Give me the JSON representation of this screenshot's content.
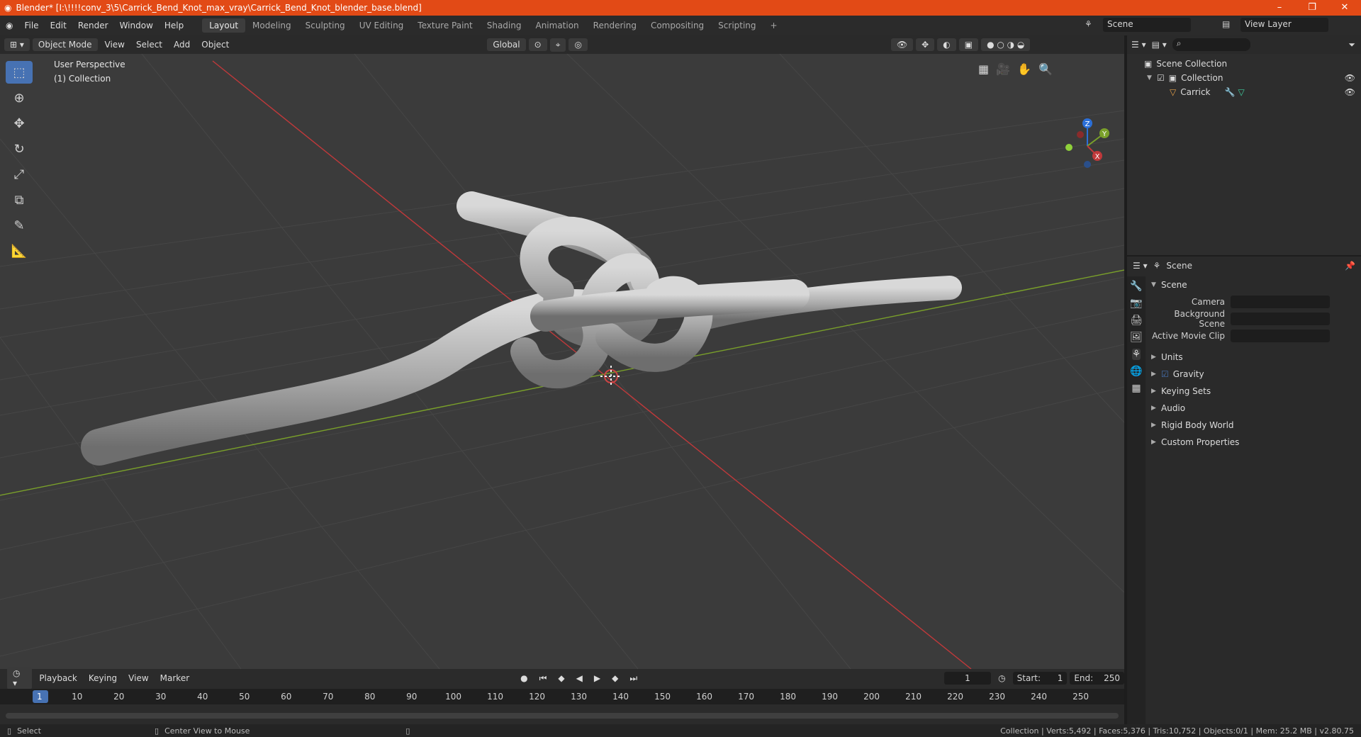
{
  "title": "Blender* [I:\\!!!!conv_3\\5\\Carrick_Bend_Knot_max_vray\\Carrick_Bend_Knot_blender_base.blend]",
  "window_controls": {
    "minimize": "–",
    "maximize": "❐",
    "close": "✕"
  },
  "menu": [
    "File",
    "Edit",
    "Render",
    "Window",
    "Help"
  ],
  "workspaces": [
    "Layout",
    "Modeling",
    "Sculpting",
    "UV Editing",
    "Texture Paint",
    "Shading",
    "Animation",
    "Rendering",
    "Compositing",
    "Scripting"
  ],
  "add_workspace": "+",
  "scene_selector": "Scene",
  "view_layer": "View Layer",
  "viewport_header": {
    "mode": "Object Mode",
    "items": [
      "View",
      "Select",
      "Add",
      "Object"
    ],
    "transform_orientation": "Global"
  },
  "viewport_info": {
    "perspective": "User Perspective",
    "collection": "(1) Collection"
  },
  "gizmo": {
    "x": "X",
    "y": "Y",
    "z": "Z"
  },
  "outliner": {
    "root": "Scene Collection",
    "collection": "Collection",
    "object": "Carrick"
  },
  "properties": {
    "header": "Scene",
    "section": "Scene",
    "fields": [
      {
        "label": "Camera"
      },
      {
        "label": "Background Scene"
      },
      {
        "label": "Active Movie Clip"
      }
    ],
    "panels": [
      "Units",
      "Gravity",
      "Keying Sets",
      "Audio",
      "Rigid Body World",
      "Custom Properties"
    ]
  },
  "timeline": {
    "menus": [
      "Playback",
      "Keying",
      "View",
      "Marker"
    ],
    "current_frame": "1",
    "start_label": "Start:",
    "start": "1",
    "end_label": "End:",
    "end": "250",
    "frame_marks": [
      "1",
      "10",
      "20",
      "30",
      "40",
      "50",
      "60",
      "70",
      "80",
      "90",
      "100",
      "110",
      "120",
      "130",
      "140",
      "150",
      "160",
      "170",
      "180",
      "190",
      "200",
      "210",
      "220",
      "230",
      "240",
      "250"
    ]
  },
  "statusbar": {
    "left": "Select",
    "middle": "Center View to Mouse",
    "right": "Collection | Verts:5,492 | Faces:5,376 | Tris:10,752 | Objects:0/1 | Mem: 25.2 MB | v2.80.75"
  },
  "colors": {
    "accent": "#4772b3",
    "titlebar": "#e24a16",
    "x_axis": "#c0393b",
    "y_axis": "#7aa02a"
  }
}
